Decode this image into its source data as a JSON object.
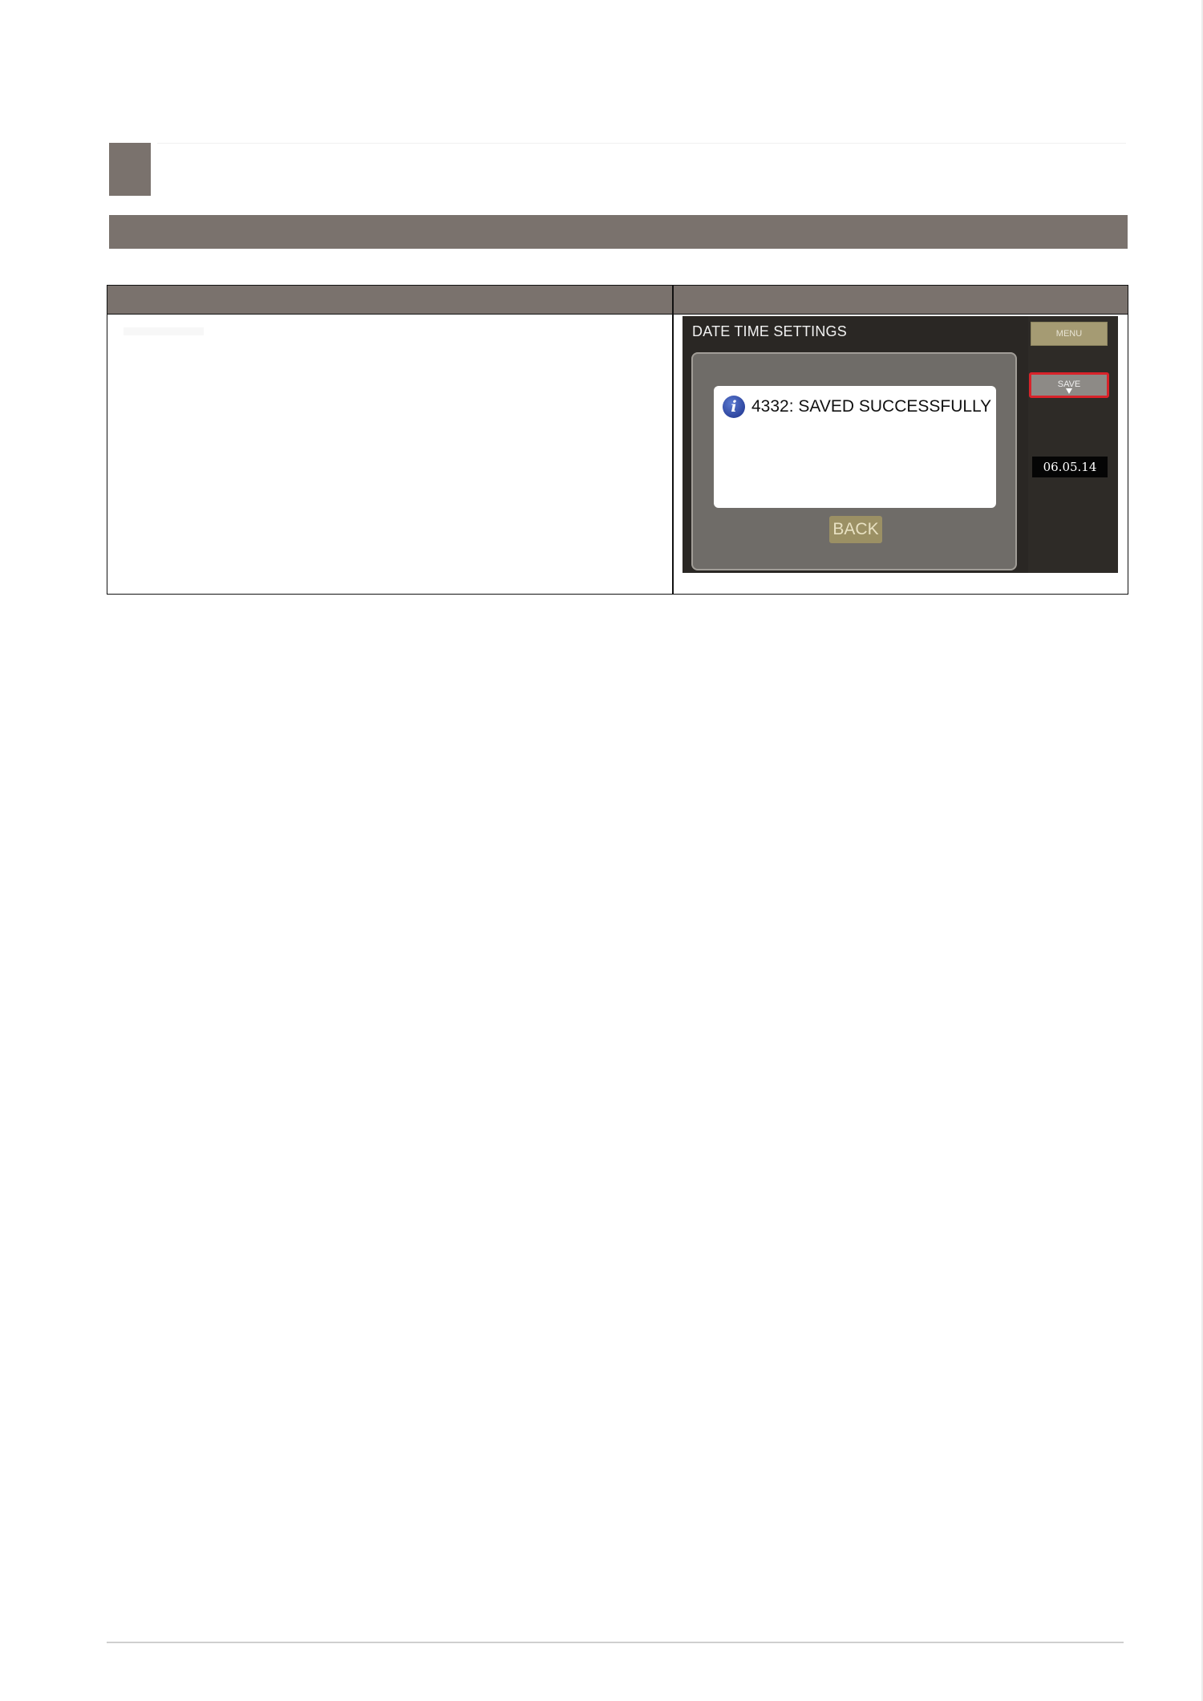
{
  "device": {
    "title": "DATE TIME SETTINGS",
    "menu_label": "MENU",
    "save_label": "SAVE",
    "date_value": "06.05.14",
    "dialog": {
      "message": "4332: SAVED SUCCESSFULLY",
      "back_label": "BACK"
    },
    "colors": {
      "screen_bg": "#2a2724",
      "button_gold": "#a59b73",
      "highlight_red": "#d8232a"
    }
  },
  "page": {
    "header_color": "#7a726d"
  }
}
